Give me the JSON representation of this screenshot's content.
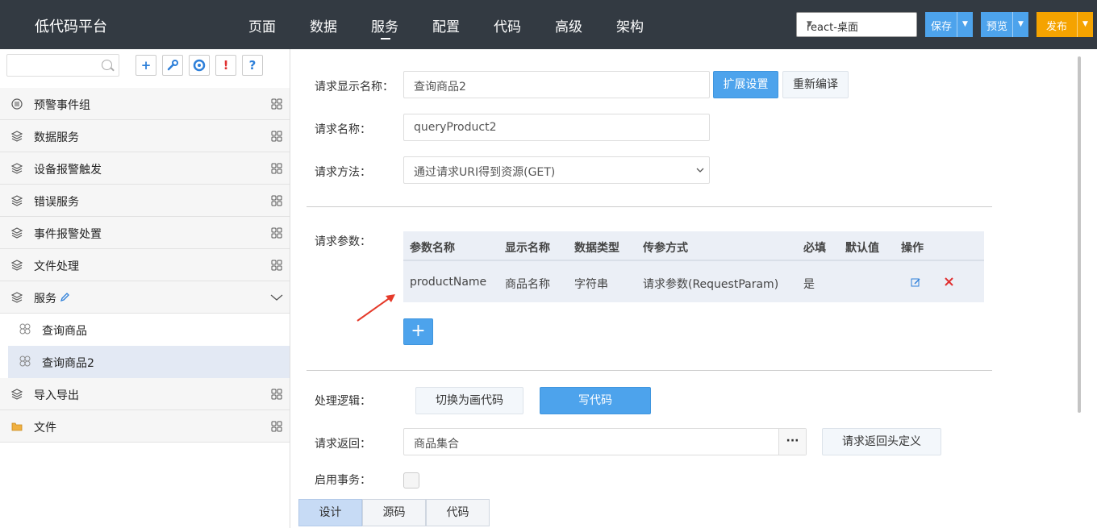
{
  "app": {
    "title": "低代码平台"
  },
  "nav": {
    "items": [
      "页面",
      "数据",
      "服务",
      "配置",
      "代码",
      "高级",
      "架构"
    ],
    "active": "服务"
  },
  "toolbar": {
    "env": "react-桌面",
    "save": "保存",
    "preview": "预览",
    "publish": "发布"
  },
  "sidebar": {
    "search_placeholder": "",
    "groups": [
      {
        "label": "预警事件组"
      },
      {
        "label": "数据服务"
      },
      {
        "label": "设备报警触发"
      },
      {
        "label": "错误服务"
      },
      {
        "label": "事件报警处置"
      },
      {
        "label": "文件处理"
      },
      {
        "label": "服务"
      },
      {
        "label": "导入导出"
      },
      {
        "label": "文件"
      }
    ],
    "subitems": [
      {
        "label": "查询商品"
      },
      {
        "label": "查询商品2"
      }
    ]
  },
  "form": {
    "display_name_label": "请求显示名称：",
    "display_name_value": "查询商品2",
    "ext_settings": "扩展设置",
    "recompile": "重新编译",
    "name_label": "请求名称：",
    "name_value": "queryProduct2",
    "method_label": "请求方法：",
    "method_value": "通过请求URI得到资源(GET)",
    "params_label": "请求参数：",
    "logic_label": "处理逻辑：",
    "switch_visual": "切换为画代码",
    "write_code": "写代码",
    "return_label": "请求返回：",
    "return_value": "商品集合",
    "return_more": "···",
    "return_header": "请求返回头定义",
    "transaction_label": "启用事务："
  },
  "params_table": {
    "headers": [
      "参数名称",
      "显示名称",
      "数据类型",
      "传参方式",
      "必填",
      "默认值",
      "操作"
    ],
    "rows": [
      {
        "name": "productName",
        "display": "商品名称",
        "type": "字符串",
        "mode": "请求参数(RequestParam)",
        "required": "是",
        "default": ""
      }
    ]
  },
  "bottom_tabs": {
    "items": [
      "设计",
      "源码",
      "代码"
    ],
    "active": "设计"
  },
  "colors": {
    "topbar": "#333a42",
    "accent": "#4da3ec",
    "publish": "#f5a300",
    "delete": "#e03030"
  }
}
